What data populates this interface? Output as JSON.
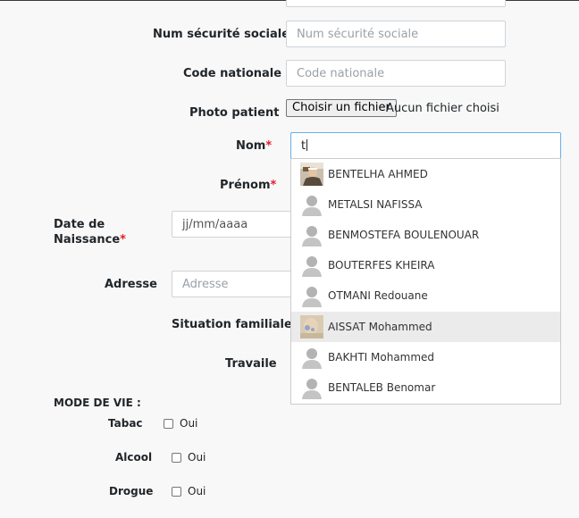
{
  "form": {
    "num_securite": {
      "label": "Num sécurité sociale",
      "placeholder": "Num sécurité sociale"
    },
    "code_nationale": {
      "label": "Code nationale",
      "placeholder": "Code nationale"
    },
    "photo": {
      "label": "Photo patient",
      "button": "Choisir un fichier",
      "status": "Aucun fichier choisi"
    },
    "nom": {
      "label": "Nom",
      "required_mark": "*",
      "value": "t"
    },
    "prenom": {
      "label": "Prénom",
      "required_mark": "*"
    },
    "date_naissance": {
      "label_line1": "Date de",
      "label_line2": "Naissance",
      "required_mark": "*",
      "placeholder": "jj/mm/aaaa"
    },
    "adresse": {
      "label": "Adresse",
      "placeholder": "Adresse"
    },
    "situation_familiale": {
      "label": "Situation familiale"
    },
    "travaile": {
      "label": "Travaile"
    },
    "mode_de_vie": {
      "title": "MODE DE VIE :",
      "items": [
        {
          "label": "Tabac",
          "option": "Oui",
          "checked": false
        },
        {
          "label": "Alcool",
          "option": "Oui",
          "checked": false
        },
        {
          "label": "Drogue",
          "option": "Oui",
          "checked": false
        }
      ]
    }
  },
  "autocomplete": {
    "highlighted_index": 5,
    "items": [
      {
        "name": "BENTELHA AHMED",
        "avatar": "photo-avatar"
      },
      {
        "name": "METALSI NAFISSA",
        "avatar": "default-user-icon"
      },
      {
        "name": "BENMOSTEFA BOULENOUAR",
        "avatar": "default-user-icon"
      },
      {
        "name": "BOUTERFES KHEIRA",
        "avatar": "default-user-icon"
      },
      {
        "name": "OTMANI Redouane",
        "avatar": "default-user-icon"
      },
      {
        "name": "AISSAT Mohammed",
        "avatar": "photo-avatar"
      },
      {
        "name": "BAKHTI Mohammed",
        "avatar": "default-user-icon"
      },
      {
        "name": "BENTALEB Benomar",
        "avatar": "default-user-icon"
      }
    ]
  },
  "colors": {
    "required": "#e0202e",
    "focus_border": "#66afe9",
    "highlight_row": "#ebebeb"
  }
}
